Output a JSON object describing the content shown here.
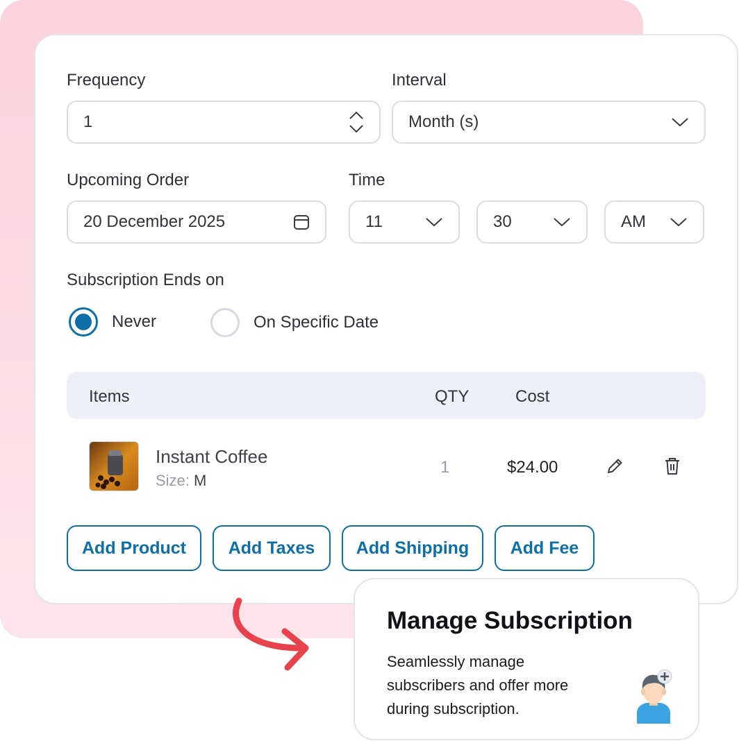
{
  "form": {
    "frequency": {
      "label": "Frequency",
      "value": "1"
    },
    "interval": {
      "label": "Interval",
      "value": "Month (s)"
    },
    "upcoming_order": {
      "label": "Upcoming Order",
      "value": "20 December 2025"
    },
    "time": {
      "label": "Time",
      "hour": "11",
      "minute": "30",
      "period": "AM"
    },
    "ends_on": {
      "label": "Subscription Ends on",
      "options": [
        {
          "label": "Never",
          "selected": true
        },
        {
          "label": "On Specific Date",
          "selected": false
        }
      ]
    }
  },
  "table": {
    "headers": {
      "items": "Items",
      "qty": "QTY",
      "cost": "Cost"
    },
    "rows": [
      {
        "name": "Instant Coffee",
        "size_label": "Size:",
        "size_value": "M",
        "qty": "1",
        "cost": "$24.00"
      }
    ]
  },
  "buttons": {
    "add_product": "Add Product",
    "add_taxes": "Add Taxes",
    "add_shipping": "Add Shipping",
    "add_fee": "Add Fee"
  },
  "promo": {
    "title": "Manage Subscription",
    "lines": [
      "Seamlessly manage",
      "subscribers and offer more",
      "during subscription."
    ]
  },
  "colors": {
    "accent": "#0d6fa5",
    "pink_backdrop": "#fcd3dd",
    "arrow": "#e8424d"
  },
  "icons": {
    "stepper": "up-down-chevron-icon",
    "dropdown": "chevron-down-icon",
    "calendar": "calendar-icon",
    "edit": "pencil-icon",
    "delete": "trash-icon",
    "arrow": "curved-arrow-icon",
    "avatar": "user-add-avatar-icon"
  }
}
